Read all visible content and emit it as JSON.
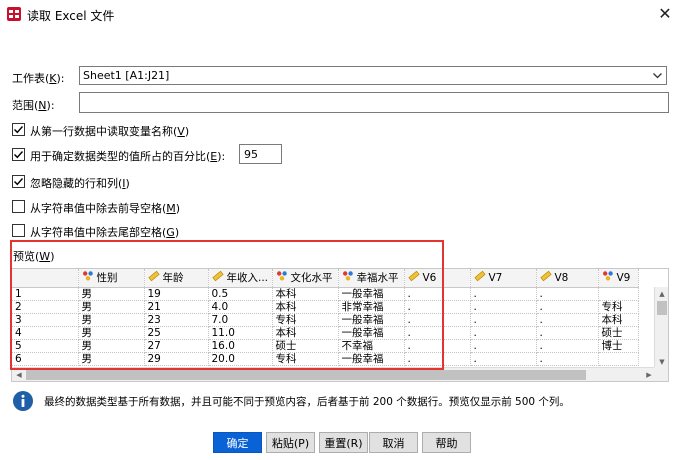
{
  "window": {
    "title": "读取 Excel 文件",
    "close_glyph": "✕"
  },
  "sheet": {
    "label": "工作表(",
    "mnemonic": "K",
    "label_end": "):",
    "selected": "Sheet1 [A1:J21]"
  },
  "range": {
    "label": "范围(",
    "mnemonic": "N",
    "label_end": "):",
    "value": ""
  },
  "options": {
    "read_names": {
      "label": "从第一行数据中读取变量名称(",
      "mnemonic": "V",
      "end": ")",
      "checked": true
    },
    "percent": {
      "label": "用于确定数据类型的值所占的百分比(",
      "mnemonic": "E",
      "end": "):",
      "checked": true,
      "value": "95"
    },
    "ignore_hidden": {
      "label": "忽略隐藏的行和列(",
      "mnemonic": "I",
      "end": ")",
      "checked": true
    },
    "trim_leading": {
      "label": "从字符串值中除去前导空格(",
      "mnemonic": "M",
      "end": ")",
      "checked": false
    },
    "trim_trailing": {
      "label": "从字符串值中除去尾部空格(",
      "mnemonic": "G",
      "end": ")",
      "checked": false
    }
  },
  "preview": {
    "label": "预览(",
    "mnemonic": "W",
    "label_end": ")",
    "columns": [
      {
        "name": "性别",
        "icon": "nominal-icon"
      },
      {
        "name": "年龄",
        "icon": "scale-icon"
      },
      {
        "name": "年收入...",
        "icon": "scale-icon"
      },
      {
        "name": "文化水平",
        "icon": "nominal-icon"
      },
      {
        "name": "幸福水平",
        "icon": "nominal-icon"
      },
      {
        "name": "V6",
        "icon": "scale-icon"
      },
      {
        "name": "V7",
        "icon": "scale-icon"
      },
      {
        "name": "V8",
        "icon": "scale-icon"
      },
      {
        "name": "V9",
        "icon": "nominal-icon"
      }
    ],
    "rows": [
      {
        "n": "1",
        "cells": [
          "男",
          "19",
          "0.5",
          "本科",
          "一般幸福",
          ".",
          ".",
          ".",
          ""
        ]
      },
      {
        "n": "2",
        "cells": [
          "男",
          "21",
          "4.0",
          "本科",
          "非常幸福",
          ".",
          ".",
          ".",
          "专科"
        ]
      },
      {
        "n": "3",
        "cells": [
          "男",
          "23",
          "7.0",
          "专科",
          "一般幸福",
          ".",
          ".",
          ".",
          "本科"
        ]
      },
      {
        "n": "4",
        "cells": [
          "男",
          "25",
          "11.0",
          "本科",
          "一般幸福",
          ".",
          ".",
          ".",
          "硕士"
        ]
      },
      {
        "n": "5",
        "cells": [
          "男",
          "27",
          "16.0",
          "硕士",
          "不幸福",
          ".",
          ".",
          ".",
          "博士"
        ]
      },
      {
        "n": "6",
        "cells": [
          "男",
          "29",
          "20.0",
          "专科",
          "一般幸福",
          ".",
          ".",
          ".",
          ""
        ]
      }
    ]
  },
  "info": {
    "text": "最终的数据类型基于所有数据，并且可能不同于预览内容，后者基于前 200 个数据行。预览仅显示前 500 个列。"
  },
  "buttons": {
    "ok": "确定",
    "paste": "粘贴(P)",
    "reset": "重置(R)",
    "cancel": "取消",
    "help": "帮助"
  },
  "colors": {
    "primary_button": "#0a63d6",
    "highlight_frame": "#e3342f",
    "info_icon": "#1f5fa8"
  }
}
